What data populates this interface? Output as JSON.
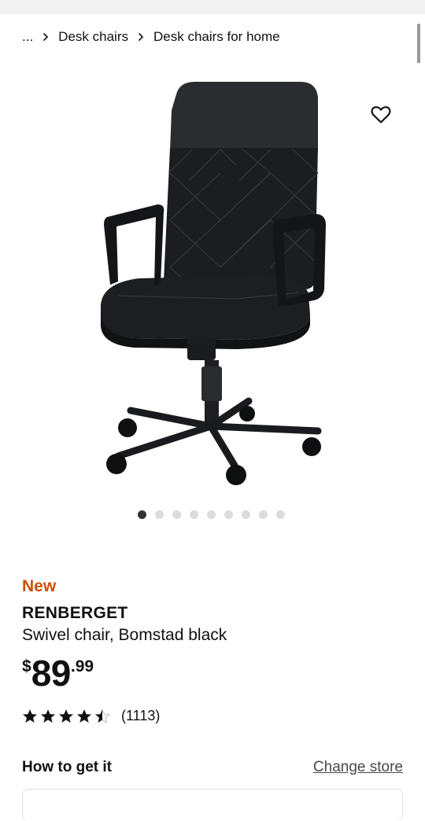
{
  "breadcrumb": {
    "ellipsis": "...",
    "items": [
      "Desk chairs",
      "Desk chairs for home"
    ]
  },
  "gallery": {
    "image_alt": "RENBERGET swivel chair",
    "dot_count": 9,
    "active_dot": 0
  },
  "product": {
    "badge": "New",
    "name": "RENBERGET",
    "description": "Swivel chair, Bomstad black",
    "price": {
      "currency": "$",
      "integer": "89",
      "decimal": ".99"
    },
    "rating": {
      "stars": 4.5,
      "count": "(1113)"
    }
  },
  "availability": {
    "heading": "How to get it",
    "change_store": "Change store"
  },
  "colors": {
    "badge_new": "#ca5008",
    "text": "#111111",
    "dot_active": "#333333",
    "dot_inactive": "#dcdcdc"
  },
  "icons": {
    "favorite": "heart-outline-icon",
    "separator": "chevron-right-icon",
    "star": "star-icon"
  }
}
